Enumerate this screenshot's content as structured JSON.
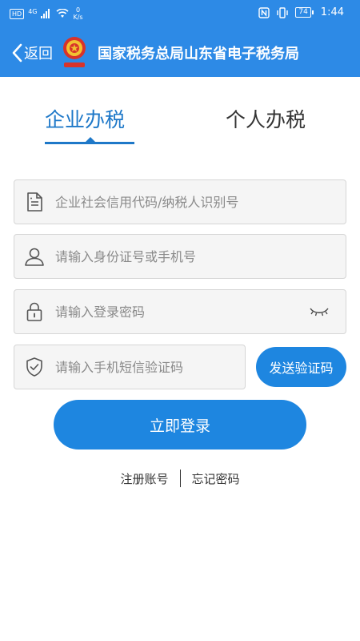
{
  "status_bar": {
    "hd": "HD",
    "network": "4G",
    "speed_value": "0",
    "speed_unit": "K/s",
    "battery": "74",
    "time": "1:44"
  },
  "header": {
    "back_label": "返回",
    "title": "国家税务总局山东省电子税务局"
  },
  "tabs": [
    {
      "label": "企业办税",
      "active": true
    },
    {
      "label": "个人办税",
      "active": false
    }
  ],
  "form": {
    "credit_code_placeholder": "企业社会信用代码/纳税人识别号",
    "id_phone_placeholder": "请输入身份证号或手机号",
    "password_placeholder": "请输入登录密码",
    "sms_code_placeholder": "请输入手机短信验证码",
    "send_code_label": "发送验证码",
    "login_label": "立即登录"
  },
  "links": {
    "register": "注册账号",
    "forgot": "忘记密码"
  },
  "colors": {
    "header_bg": "#2d8ae6",
    "accent": "#1e78c8",
    "button": "#1e86e0"
  }
}
